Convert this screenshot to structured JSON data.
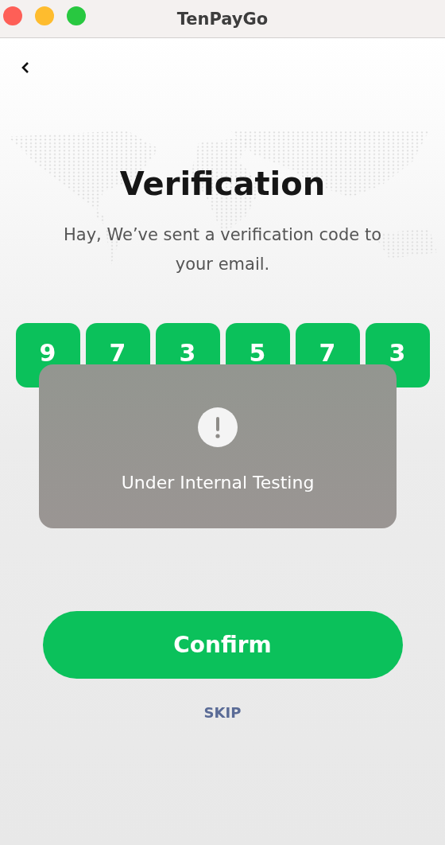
{
  "window": {
    "title": "TenPayGo"
  },
  "heading": "Verification",
  "message": "Hay, We’ve sent a verification code to your email.",
  "code_digits": [
    "9",
    "7",
    "3",
    "5",
    "7",
    "3"
  ],
  "toast": {
    "text": "Under Internal Testing"
  },
  "buttons": {
    "confirm": "Confirm",
    "skip": "SKIP"
  }
}
